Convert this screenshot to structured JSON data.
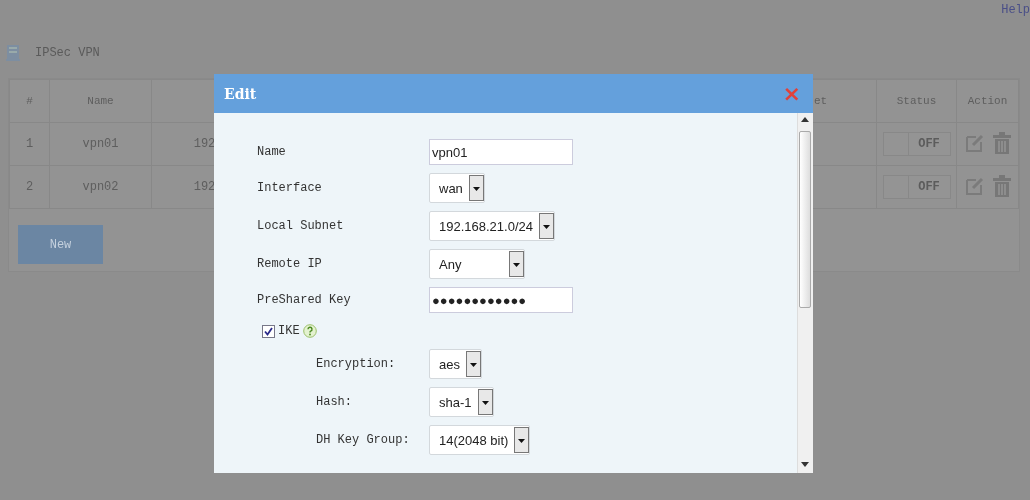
{
  "header_link": "Help",
  "page_title": "IPSec VPN",
  "table": {
    "columns": [
      "#",
      "Name",
      "et",
      "Status",
      "Action"
    ],
    "rows": [
      {
        "index": "1",
        "name": "vpn01",
        "column_3": "192",
        "status": {
          "on": false,
          "label": "OFF"
        }
      },
      {
        "index": "2",
        "name": "vpn02",
        "column_3": "192",
        "status": {
          "on": false,
          "label": "OFF"
        }
      }
    ]
  },
  "new_button": "New",
  "dialog": {
    "title": "Edit",
    "close": "×",
    "fields": [
      {
        "kind": "text",
        "label": "Name",
        "value": "vpn01"
      },
      {
        "kind": "select",
        "label": "Interface",
        "value": "wan"
      },
      {
        "kind": "select",
        "label": "Local Subnet",
        "value": "192.168.21.0/24"
      },
      {
        "kind": "select",
        "label": "Remote IP",
        "value": "Any"
      },
      {
        "kind": "text",
        "label": "PreShared Key",
        "value": "●●●●●●●●●●●●"
      }
    ],
    "ike": {
      "label": "IKE",
      "checked": true
    },
    "ike_fields": [
      {
        "kind": "select",
        "label": "Encryption:",
        "value": "aes"
      },
      {
        "kind": "select",
        "label": "Hash:",
        "value": "sha-1"
      },
      {
        "kind": "select",
        "label": "DH Key Group:",
        "value": "14(2048 bit)"
      }
    ]
  }
}
